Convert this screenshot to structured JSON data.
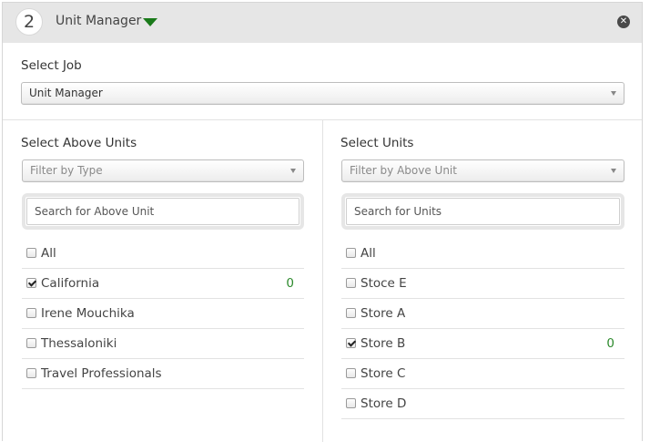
{
  "header": {
    "step": "2",
    "title": "Unit Manager"
  },
  "job": {
    "label": "Select Job",
    "value": "Unit Manager"
  },
  "above_units": {
    "label": "Select Above Units",
    "filter_placeholder": "Filter by Type",
    "search_placeholder": "Search for Above Unit",
    "items": [
      {
        "label": "All",
        "checked": false,
        "count": ""
      },
      {
        "label": "California",
        "checked": true,
        "count": "0"
      },
      {
        "label": "Irene Mouchika",
        "checked": false,
        "count": ""
      },
      {
        "label": "Thessaloniki",
        "checked": false,
        "count": ""
      },
      {
        "label": "Travel Professionals",
        "checked": false,
        "count": ""
      }
    ]
  },
  "units": {
    "label": "Select Units",
    "filter_placeholder": "Filter by Above Unit",
    "search_placeholder": "Search for Units",
    "items": [
      {
        "label": "All",
        "checked": false,
        "count": ""
      },
      {
        "label": "Stoce E",
        "checked": false,
        "count": ""
      },
      {
        "label": "Store A",
        "checked": false,
        "count": ""
      },
      {
        "label": "Store B",
        "checked": true,
        "count": "0"
      },
      {
        "label": "Store C",
        "checked": false,
        "count": ""
      },
      {
        "label": "Store D",
        "checked": false,
        "count": ""
      }
    ]
  },
  "colors": {
    "header_bg": "#e6e6e6",
    "accent_green": "#1a7a1a",
    "count_green": "#2d8a2d"
  }
}
